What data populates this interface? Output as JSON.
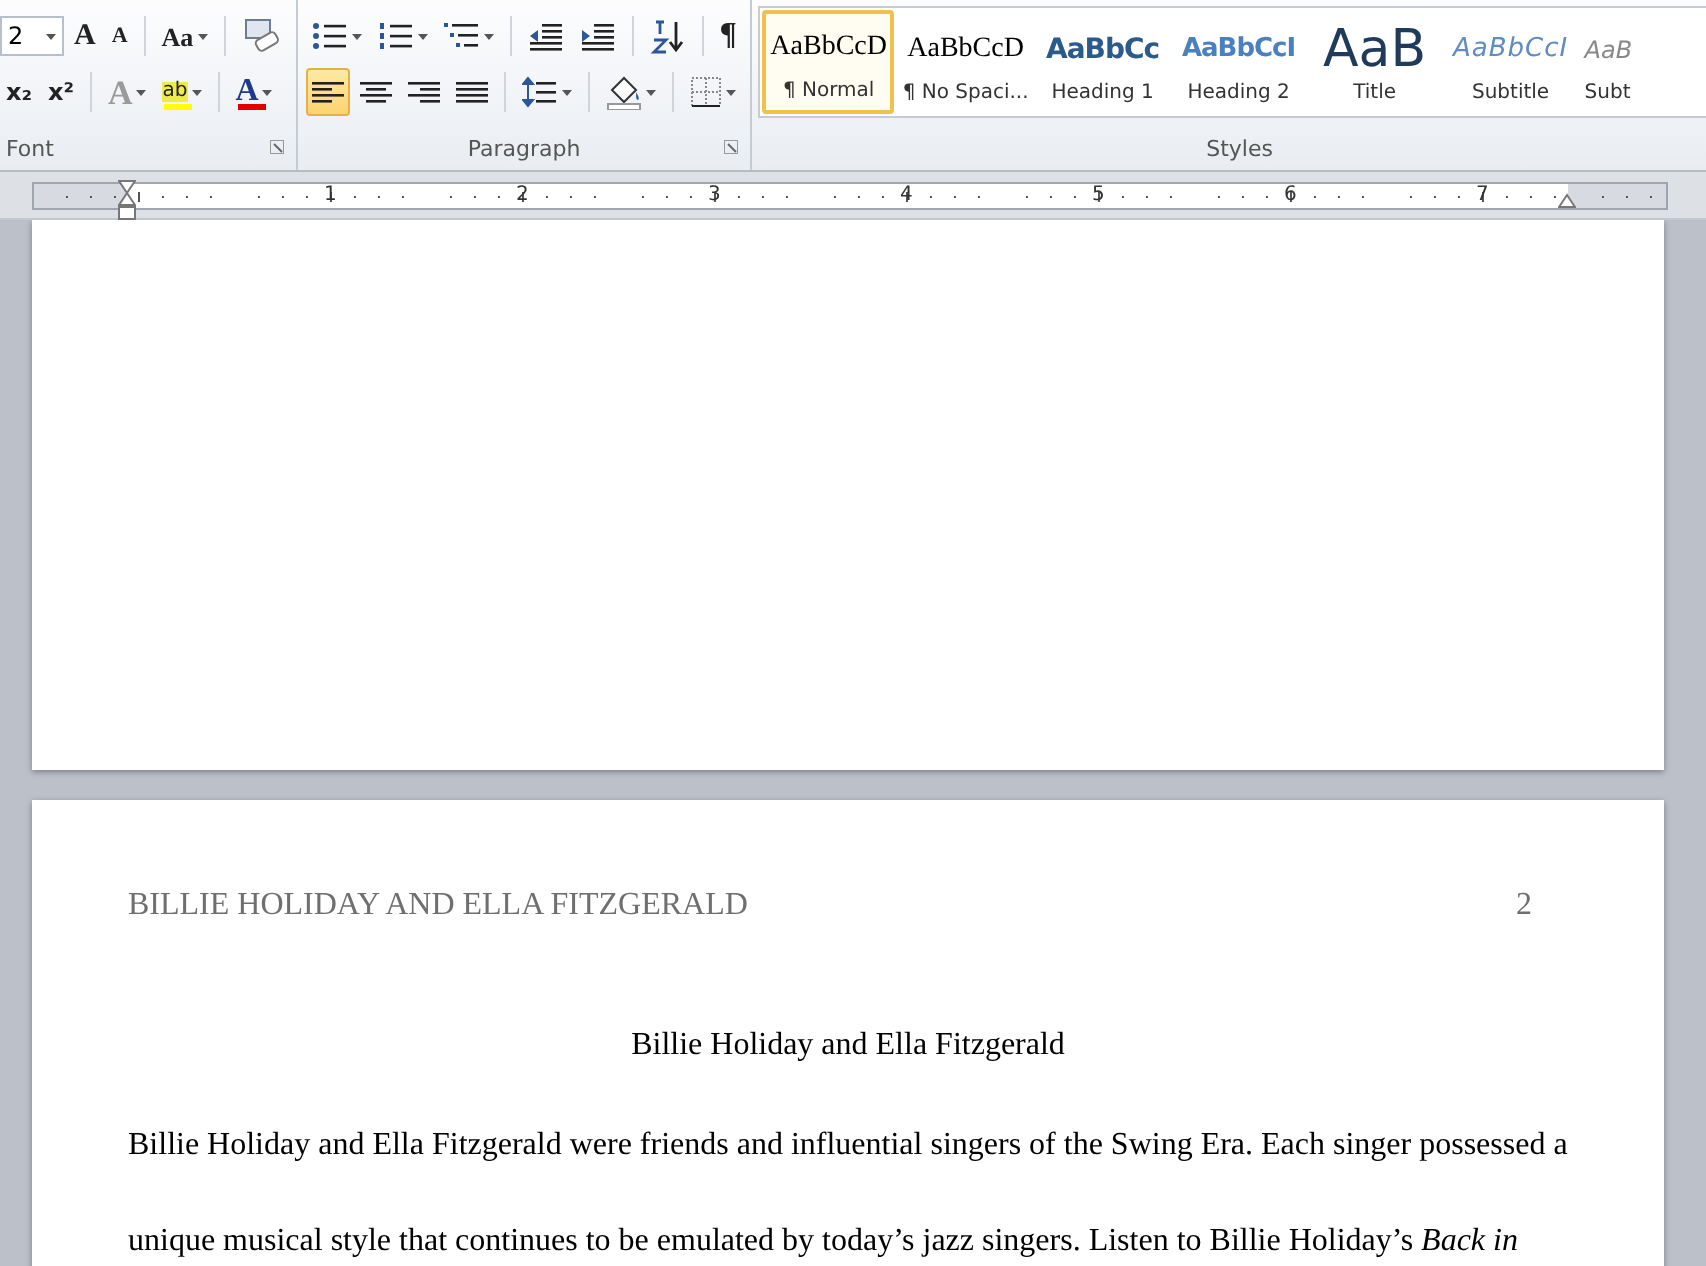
{
  "ribbon": {
    "font_group": {
      "label": "Font",
      "size_value": "2",
      "row1": [
        {
          "kind": "grow",
          "glyph": "A"
        },
        {
          "kind": "shrink",
          "glyph": "A"
        },
        {
          "kind": "case",
          "glyph": "Aa"
        },
        {
          "kind": "clear"
        }
      ],
      "row2": [
        {
          "kind": "subscript",
          "glyph": "x₂"
        },
        {
          "kind": "superscript",
          "glyph": "x²"
        },
        {
          "kind": "effects",
          "glyph": "A"
        },
        {
          "kind": "highlight",
          "glyph": "ab"
        },
        {
          "kind": "fontcolor",
          "glyph": "A"
        }
      ]
    },
    "paragraph_group": {
      "label": "Paragraph",
      "row1": [
        {
          "kind": "bullets"
        },
        {
          "kind": "numbering"
        },
        {
          "kind": "multilevel"
        },
        {
          "kind": "outdent"
        },
        {
          "kind": "indent"
        },
        {
          "kind": "sort"
        },
        {
          "kind": "pilcrow",
          "glyph": "¶"
        }
      ],
      "alignment": [
        {
          "kind": "left",
          "selected": true
        },
        {
          "kind": "center",
          "selected": false
        },
        {
          "kind": "right",
          "selected": false
        },
        {
          "kind": "justify",
          "selected": false
        }
      ],
      "row2": [
        {
          "kind": "spacing"
        },
        {
          "kind": "shading"
        },
        {
          "kind": "borders"
        }
      ]
    },
    "styles_group": {
      "label": "Styles",
      "items": [
        {
          "kind": "normal",
          "preview": "AaBbCcD",
          "name": "¶ Normal",
          "selected": true
        },
        {
          "kind": "nospacing",
          "preview": "AaBbCcD",
          "name": "¶ No Spaci...",
          "selected": false
        },
        {
          "kind": "heading1",
          "preview": "AaBbCc",
          "name": "Heading 1",
          "selected": false
        },
        {
          "kind": "heading2",
          "preview": "AaBbCcI",
          "name": "Heading 2",
          "selected": false
        },
        {
          "kind": "title",
          "preview": "AaB",
          "name": "Title",
          "selected": false
        },
        {
          "kind": "subtitle",
          "preview": "AaBbCcI",
          "name": "Subtitle",
          "selected": false
        },
        {
          "kind": "subtle",
          "preview": "AaB",
          "name": "Subt",
          "selected": false
        }
      ]
    }
  },
  "ruler": {
    "numbers": [
      "1",
      "2",
      "3",
      "4",
      "5",
      "6",
      "7"
    ]
  },
  "page2": {
    "header": "BILLIE HOLIDAY AND ELLA FITZGERALD",
    "page_number": "2",
    "title": "Billie  Holiday and Ella Fitzgerald",
    "paragraph": "Billie  Holiday and Ella Fitzgerald were friends and influential singers  of the Swing Era. Each singer possessed a unique musical style that continues to be emulated by today’s jazz singers. Listen to Billie Holiday’s *Back in*"
  }
}
